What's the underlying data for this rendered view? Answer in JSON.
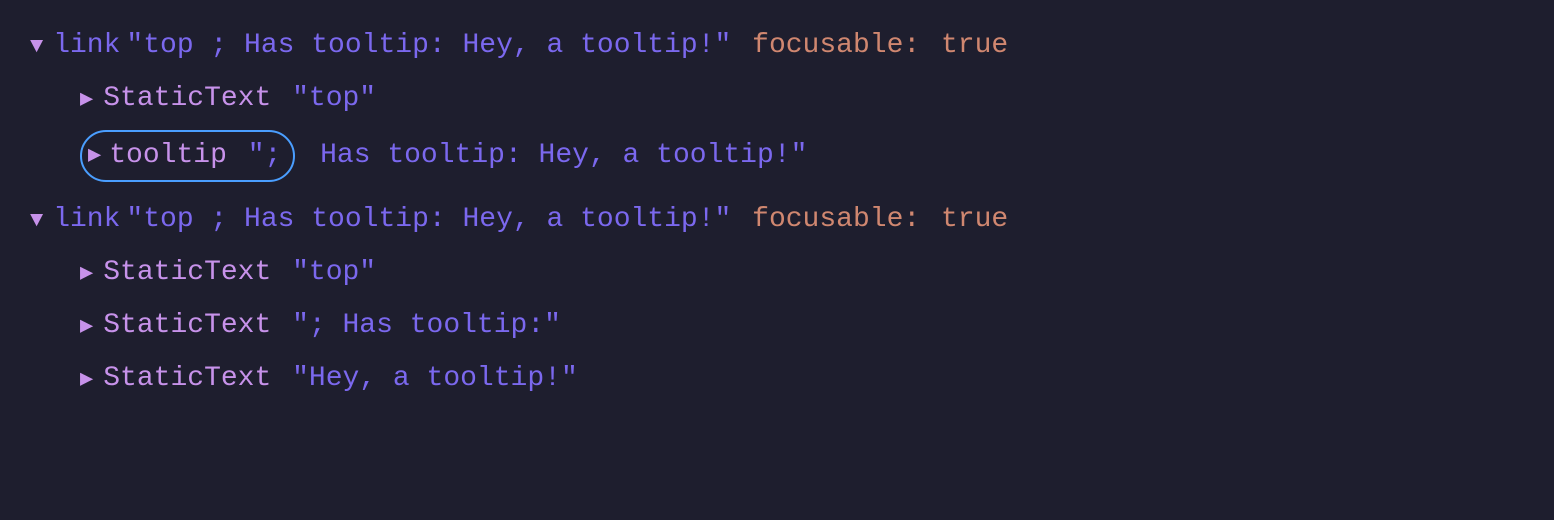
{
  "tree": {
    "block1": {
      "row1": {
        "triangle": "▼",
        "keyword": "link",
        "string": "\"top ; Has tooltip: Hey, a tooltip!\"",
        "prop_name": "focusable:",
        "prop_value": "true"
      },
      "row2": {
        "triangle": "▶",
        "keyword": "StaticText",
        "string": "\"top\""
      },
      "row3": {
        "triangle": "▶",
        "keyword": "tooltip",
        "string": "\";",
        "rest": "Has tooltip: Hey, a tooltip!\""
      }
    },
    "block2": {
      "row1": {
        "triangle": "▼",
        "keyword": "link",
        "string": "\"top ; Has tooltip: Hey, a tooltip!\"",
        "prop_name": "focusable:",
        "prop_value": "true"
      },
      "row2": {
        "triangle": "▶",
        "keyword": "StaticText",
        "string": "\"top\""
      },
      "row3": {
        "triangle": "▶",
        "keyword": "StaticText",
        "string": "\"; Has tooltip:\""
      },
      "row4": {
        "triangle": "▶",
        "keyword": "StaticText",
        "string": "\"Hey, a tooltip!\""
      }
    }
  }
}
